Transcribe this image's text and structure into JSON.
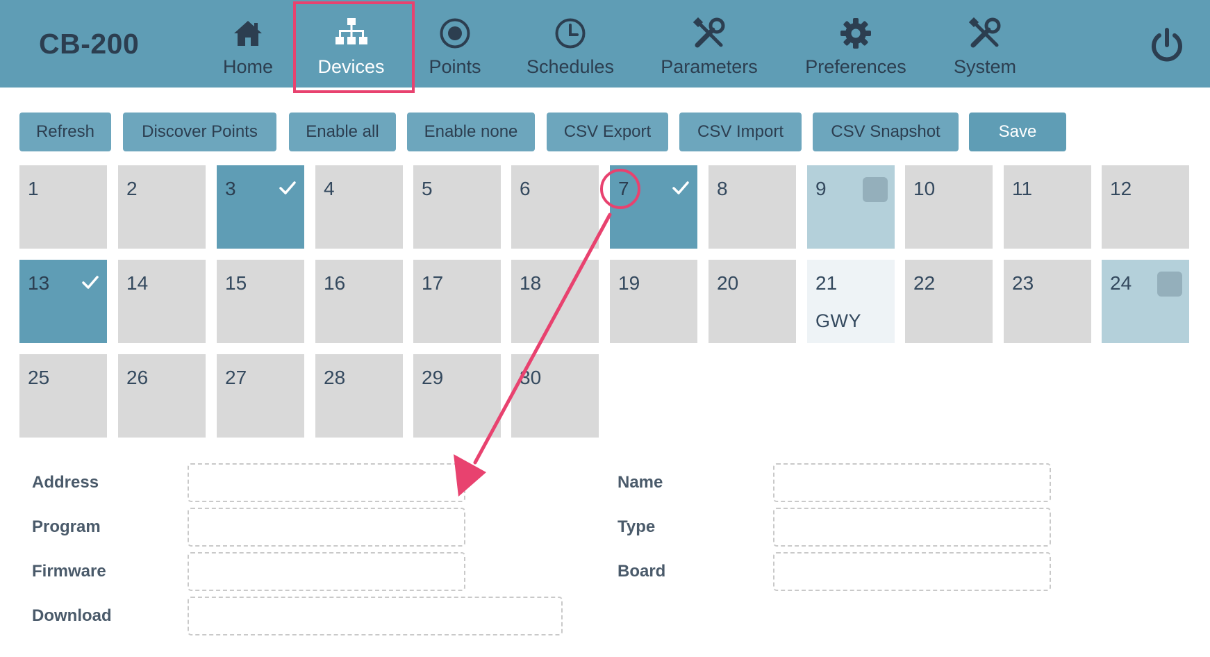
{
  "app": {
    "title": "CB-200"
  },
  "nav": [
    {
      "label": "Home",
      "icon": "home-icon"
    },
    {
      "label": "Devices",
      "icon": "sitemap-icon",
      "active": true
    },
    {
      "label": "Points",
      "icon": "record-icon"
    },
    {
      "label": "Schedules",
      "icon": "clock-icon"
    },
    {
      "label": "Parameters",
      "icon": "tools-icon"
    },
    {
      "label": "Preferences",
      "icon": "gear-icon"
    },
    {
      "label": "System",
      "icon": "tools-icon"
    }
  ],
  "power_icon": "power-icon",
  "toolbar": {
    "refresh": "Refresh",
    "discover_points": "Discover Points",
    "enable_all": "Enable all",
    "enable_none": "Enable none",
    "csv_export": "CSV Export",
    "csv_import": "CSV Import",
    "csv_snapshot": "CSV Snapshot",
    "save": "Save"
  },
  "devices": [
    {
      "num": "1"
    },
    {
      "num": "2"
    },
    {
      "num": "3",
      "state": "enabled"
    },
    {
      "num": "4"
    },
    {
      "num": "5"
    },
    {
      "num": "6"
    },
    {
      "num": "7",
      "state": "enabled"
    },
    {
      "num": "8"
    },
    {
      "num": "9",
      "state": "partial"
    },
    {
      "num": "10"
    },
    {
      "num": "11"
    },
    {
      "num": "12"
    },
    {
      "num": "13",
      "state": "enabled"
    },
    {
      "num": "14"
    },
    {
      "num": "15"
    },
    {
      "num": "16"
    },
    {
      "num": "17"
    },
    {
      "num": "18"
    },
    {
      "num": "19"
    },
    {
      "num": "20"
    },
    {
      "num": "21",
      "state": "gateway",
      "sub": "GWY"
    },
    {
      "num": "22"
    },
    {
      "num": "23"
    },
    {
      "num": "24",
      "state": "partial"
    },
    {
      "num": "25"
    },
    {
      "num": "26"
    },
    {
      "num": "27"
    },
    {
      "num": "28"
    },
    {
      "num": "29"
    },
    {
      "num": "30"
    }
  ],
  "form": {
    "address_label": "Address",
    "address_value": "",
    "program_label": "Program",
    "program_value": "",
    "firmware_label": "Firmware",
    "firmware_value": "",
    "download_label": "Download",
    "download_value": "",
    "name_label": "Name",
    "name_value": "",
    "type_label": "Type",
    "type_value": "",
    "board_label": "Board",
    "board_value": ""
  },
  "colors": {
    "header": "#5f9db5",
    "tile_enabled": "#5f9db5",
    "tile_default": "#d9d9d9",
    "tile_partial": "#b4d0da",
    "tile_gateway": "#eef3f6",
    "annotation": "#e8426f"
  }
}
